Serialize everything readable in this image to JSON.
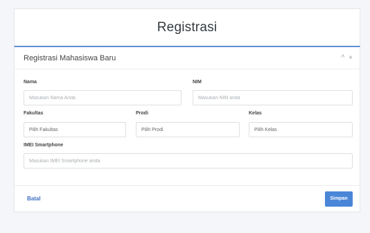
{
  "page": {
    "title": "Registrasi"
  },
  "card": {
    "title": "Registrasi Mahasiswa Baru",
    "collapse_icon": "^",
    "close_icon": "×"
  },
  "form": {
    "nama": {
      "label": "Nama",
      "placeholder": "Masukan Nama Anda"
    },
    "nim": {
      "label": "NIM",
      "placeholder": "Masukan NIM anda"
    },
    "fakultas": {
      "label": "Fakultas",
      "value": "Pilih Fakultas"
    },
    "prodi": {
      "label": "Prodi",
      "value": "Pilih Prodi"
    },
    "kelas": {
      "label": "Kelas",
      "value": "Pilih Kelas"
    },
    "imei": {
      "label": "IMEI Smartphone",
      "placeholder": "Masukan IMEI Smartphone anda"
    }
  },
  "footer": {
    "cancel_label": "Batal",
    "save_label": "Simpan"
  },
  "colors": {
    "accent": "#4a86d8",
    "card_top_border": "#5b8ed8",
    "background": "#f4f6f9"
  }
}
